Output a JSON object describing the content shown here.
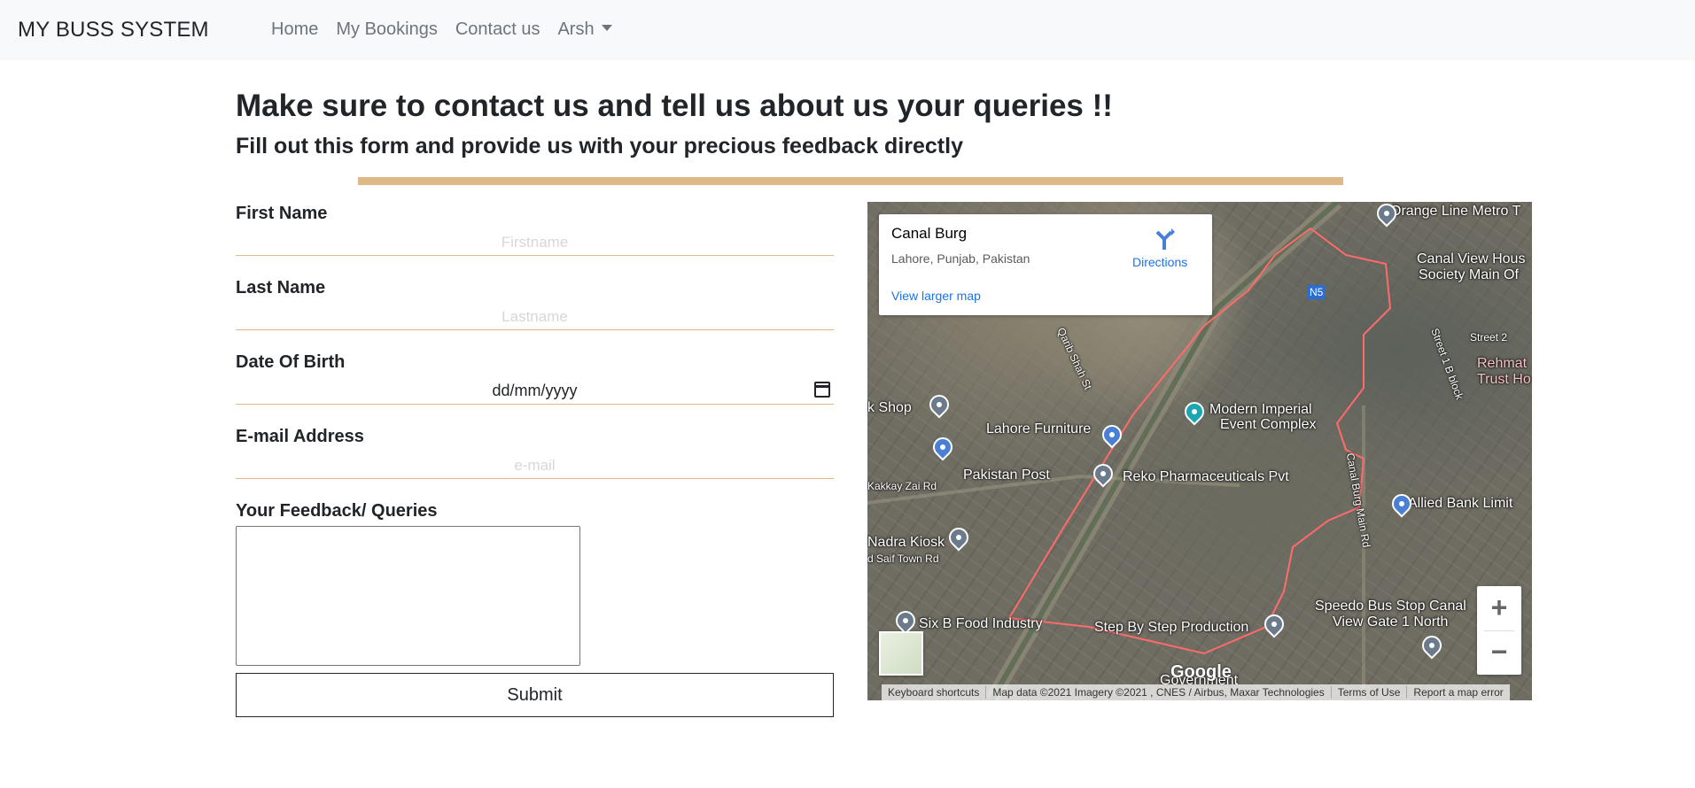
{
  "navbar": {
    "brand": "MY BUSS SYSTEM",
    "links": [
      "Home",
      "My Bookings",
      "Contact us"
    ],
    "user_menu": "Arsh"
  },
  "page": {
    "heading": "Make sure to contact us and tell us about us your queries !!",
    "subheading": "Fill out this form and provide us with your precious feedback directly"
  },
  "form": {
    "first_name": {
      "label": "First Name",
      "placeholder": "Firstname",
      "value": ""
    },
    "last_name": {
      "label": "Last Name",
      "placeholder": "Lastname",
      "value": ""
    },
    "dob": {
      "label": "Date Of Birth",
      "value": "dd/mm/yyyy"
    },
    "email": {
      "label": "E-mail Address",
      "placeholder": "e-mail",
      "value": ""
    },
    "feedback": {
      "label": "Your Feedback/ Queries",
      "value": ""
    },
    "submit_label": "Submit"
  },
  "map": {
    "place_title": "Canal Burg",
    "place_address": "Lahore, Punjab, Pakistan",
    "directions_label": "Directions",
    "larger_map_link": "View larger map",
    "zoom_in": "+",
    "zoom_out": "−",
    "google_logo": "Google",
    "attribution": [
      "Keyboard shortcuts",
      "Map data ©2021 Imagery ©2021 , CNES / Airbus, Maxar Technologies",
      "Terms of Use",
      "Report a map error"
    ],
    "labels": {
      "orange_line": "Orange Line Metro T",
      "canal_view": "Canal View Hous",
      "canal_view2": "Society Main Of",
      "street2": "Street 2",
      "rehmat": "Rehmat",
      "trust": "Trust Ho",
      "modern_imperial": "Modern Imperial",
      "event_complex": "Event Complex",
      "lahore_furniture": "Lahore Furniture",
      "pakistan_post": "Pakistan Post",
      "reko": "Reko Pharmaceuticals Pvt",
      "allied_bank": "Allied Bank Limit",
      "nadra": "Nadra Kiosk",
      "saif_town": "d Saif Town Rd",
      "kakkay_zai": "Kakkay Zai Rd",
      "six_b": "Six B Food Industry",
      "step_by_step": "Step By Step Production",
      "speedo": "Speedo Bus Stop Canal",
      "view_gate": "View Gate 1 North",
      "k_shop": "k Shop",
      "qarib_shah": "Qarib Shah St",
      "canal_burg_rd": "Canal Burg Main Rd",
      "government": "Government",
      "street1": "Street 1 B block",
      "n5": "N5"
    }
  },
  "colors": {
    "accent_rule": "#deb887",
    "navbar_bg": "#f8f9fa",
    "link": "#1a73e8"
  }
}
